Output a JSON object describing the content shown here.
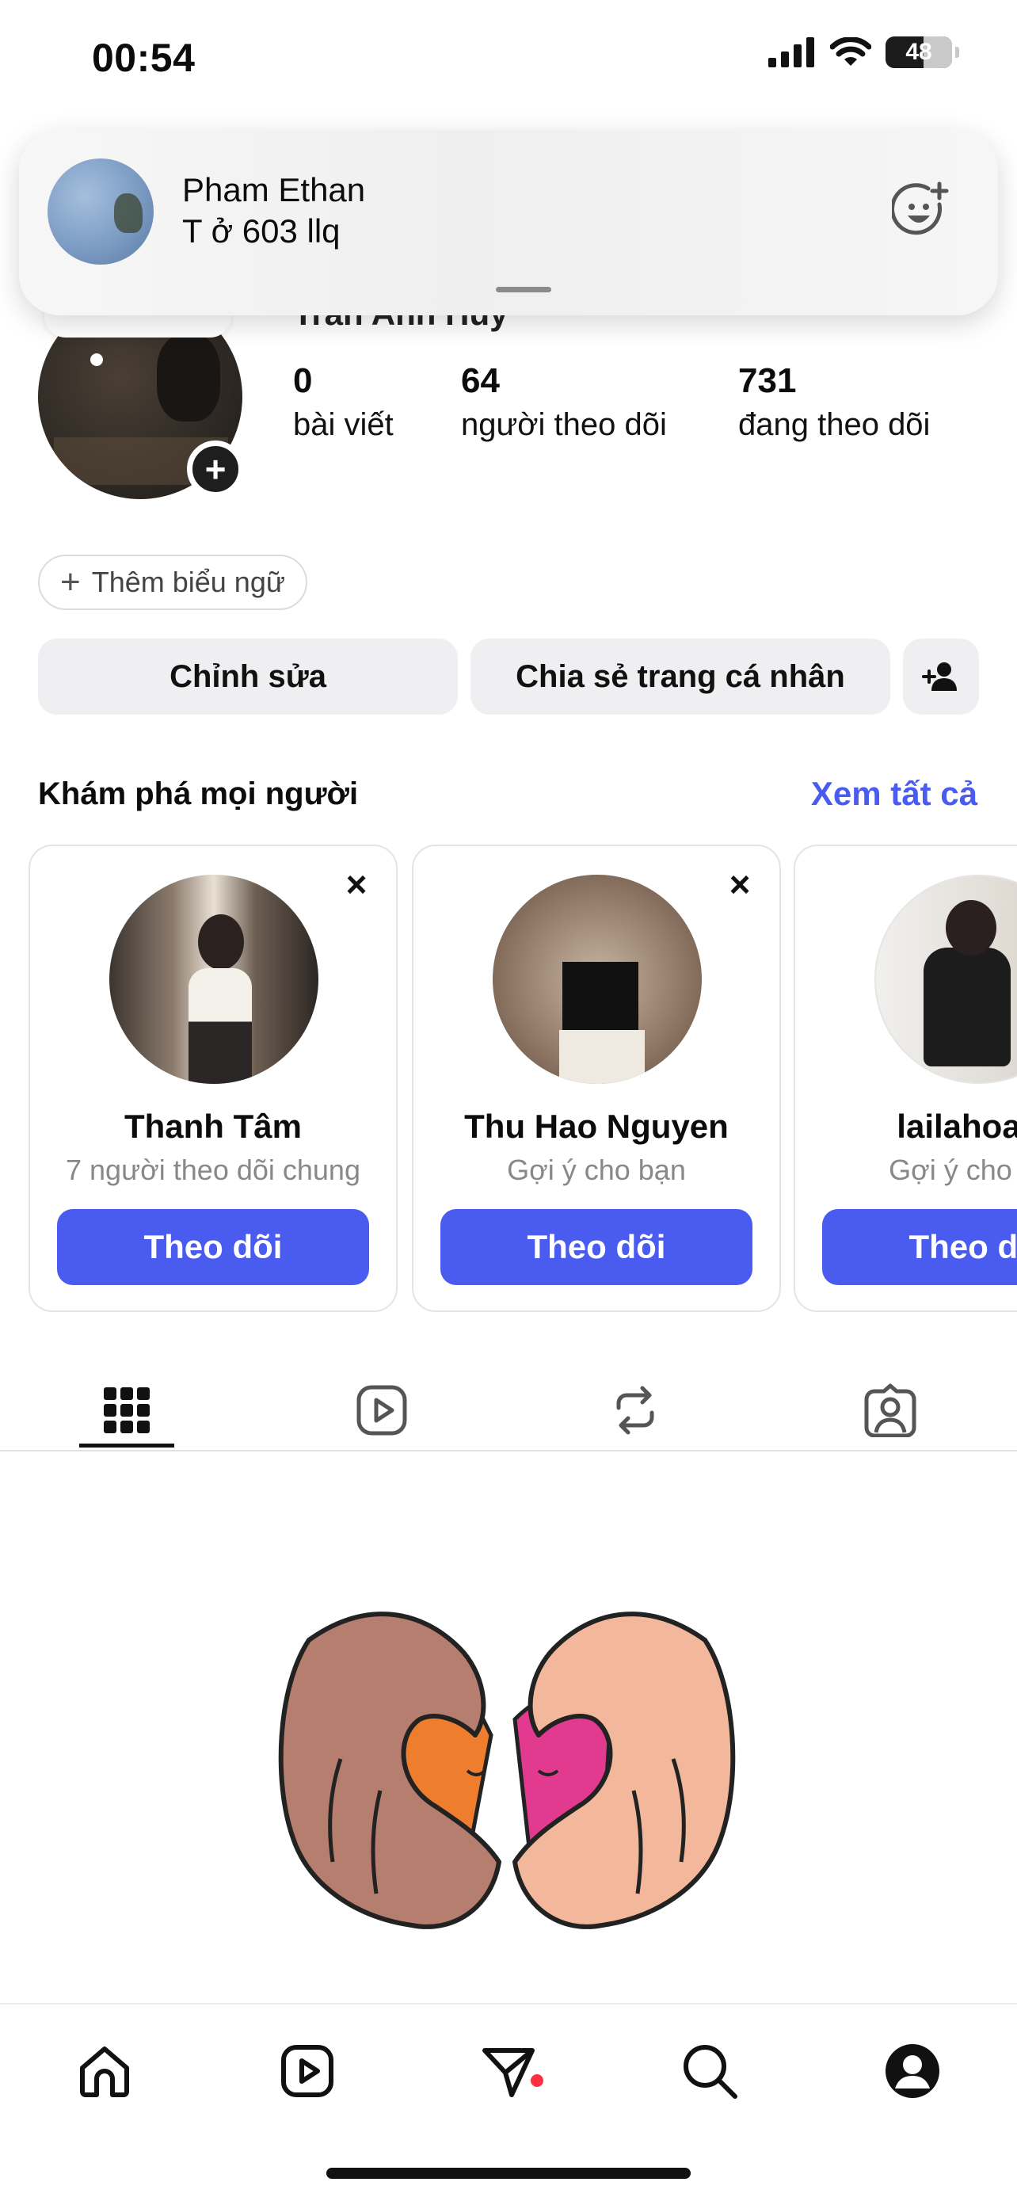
{
  "status_bar": {
    "time": "00:54",
    "battery": "48"
  },
  "notification": {
    "sender": "Pham Ethan",
    "message": "T ở 603 llq",
    "reaction_icon": "emoji-add-icon"
  },
  "profile": {
    "name": "Trần Anh Huy",
    "stats": [
      {
        "value": "0",
        "label": "bài viết"
      },
      {
        "value": "64",
        "label": "người theo dõi"
      },
      {
        "value": "731",
        "label": "đang theo dõi"
      }
    ],
    "add_banner_label": "Thêm biểu ngữ",
    "edit_label": "Chỉnh sửa",
    "share_label": "Chia sẻ trang cá nhân"
  },
  "discover": {
    "title": "Khám phá mọi người",
    "see_all": "Xem tất cả",
    "follow_label": "Theo dõi",
    "cards": [
      {
        "name": "Thanh Tâm",
        "subtitle": "7 người theo dõi chung"
      },
      {
        "name": "Thu Hao Nguyen",
        "subtitle": "Gợi ý cho bạn"
      },
      {
        "name": "lailahoada",
        "subtitle": "Gợi ý cho bạn"
      }
    ]
  },
  "tabs": [
    "grid-icon",
    "reels-icon",
    "reposts-icon",
    "tagged-icon"
  ],
  "bottom_nav": [
    "home-icon",
    "reels-icon",
    "direct-icon",
    "search-icon",
    "profile-icon"
  ],
  "colors": {
    "accent": "#4a5bf0",
    "button_bg": "#efeff1",
    "notification_dot": "#ff3040"
  }
}
